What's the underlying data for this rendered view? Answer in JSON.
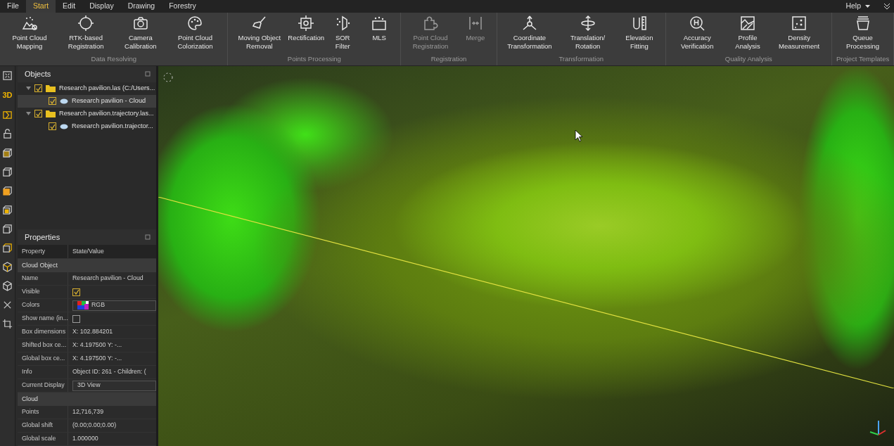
{
  "menu": {
    "items": [
      {
        "label": "File",
        "selected": false
      },
      {
        "label": "Start",
        "selected": true
      },
      {
        "label": "Edit",
        "selected": false
      },
      {
        "label": "Display",
        "selected": false
      },
      {
        "label": "Drawing",
        "selected": false
      },
      {
        "label": "Forestry",
        "selected": false
      }
    ],
    "help": "Help"
  },
  "ribbon": {
    "groups": [
      {
        "title": "Data Resolving",
        "buttons": [
          {
            "label": "Point Cloud Mapping",
            "disabled": false
          },
          {
            "label": "RTK-based Registration",
            "disabled": false
          },
          {
            "label": "Camera Calibration",
            "disabled": false
          },
          {
            "label": "Point Cloud Colorization",
            "disabled": false
          }
        ]
      },
      {
        "title": "Points Processing",
        "buttons": [
          {
            "label": "Moving Object Removal",
            "disabled": false
          },
          {
            "label": "Rectification",
            "disabled": false
          },
          {
            "label": "SOR Filter",
            "disabled": false
          },
          {
            "label": "MLS",
            "disabled": false
          }
        ]
      },
      {
        "title": "Registration",
        "buttons": [
          {
            "label": "Point Cloud Registration",
            "disabled": true
          },
          {
            "label": "Merge",
            "disabled": true
          }
        ]
      },
      {
        "title": "Transformation",
        "buttons": [
          {
            "label": "Coordinate Transformation",
            "disabled": false
          },
          {
            "label": "Translation/ Rotation",
            "disabled": false
          },
          {
            "label": "Elevation Fitting",
            "disabled": false
          }
        ]
      },
      {
        "title": "Quality Analysis",
        "buttons": [
          {
            "label": "Accuracy Verification",
            "disabled": false
          },
          {
            "label": "Profile Analysis",
            "disabled": false
          },
          {
            "label": "Density Measurement",
            "disabled": false
          }
        ]
      },
      {
        "title": "Project Templates",
        "buttons": [
          {
            "label": "Queue Processing",
            "disabled": false
          }
        ]
      }
    ]
  },
  "side_toolbar": {
    "view_label": "3D"
  },
  "objects": {
    "title": "Objects",
    "tree": [
      {
        "label": "Research pavilion.las (C:/Users...",
        "checked": true,
        "expanded": true,
        "selected": false,
        "kind": "folder",
        "children": [
          {
            "label": "Research pavilion - Cloud",
            "checked": true,
            "selected": true,
            "kind": "cloud"
          }
        ]
      },
      {
        "label": "Research pavilion.trajectory.las...",
        "checked": true,
        "expanded": true,
        "selected": false,
        "kind": "folder",
        "children": [
          {
            "label": "Research pavilion.trajector...",
            "checked": true,
            "selected": false,
            "kind": "cloud"
          }
        ]
      }
    ]
  },
  "properties": {
    "title": "Properties",
    "columns": [
      "Property",
      "State/Value"
    ],
    "sections": [
      {
        "title": "Cloud Object",
        "rows": [
          {
            "name": "Name",
            "kind": "text",
            "value": "Research pavilion - Cloud"
          },
          {
            "name": "Visible",
            "kind": "checkbox",
            "checked": true
          },
          {
            "name": "Colors",
            "kind": "color",
            "value": "RGB"
          },
          {
            "name": "Show name (in...",
            "kind": "checkbox",
            "checked": false
          },
          {
            "name": "Box dimensions",
            "kind": "text",
            "value": "X: 102.884201"
          },
          {
            "name": "Shifted box ce...",
            "kind": "text",
            "value": "X: 4.197500    Y: -..."
          },
          {
            "name": "Global box ce...",
            "kind": "text",
            "value": "X: 4.197500    Y: -..."
          },
          {
            "name": "Info",
            "kind": "text",
            "value": "Object ID: 261 - Children: ("
          },
          {
            "name": "Current Display",
            "kind": "dropdown",
            "value": "3D View"
          }
        ]
      },
      {
        "title": "Cloud",
        "rows": [
          {
            "name": "Points",
            "kind": "text",
            "value": "12,716,739"
          },
          {
            "name": "Global shift",
            "kind": "text",
            "value": "(0.00;0.00;0.00)"
          },
          {
            "name": "Global scale",
            "kind": "text",
            "value": "1.000000"
          }
        ]
      }
    ]
  }
}
